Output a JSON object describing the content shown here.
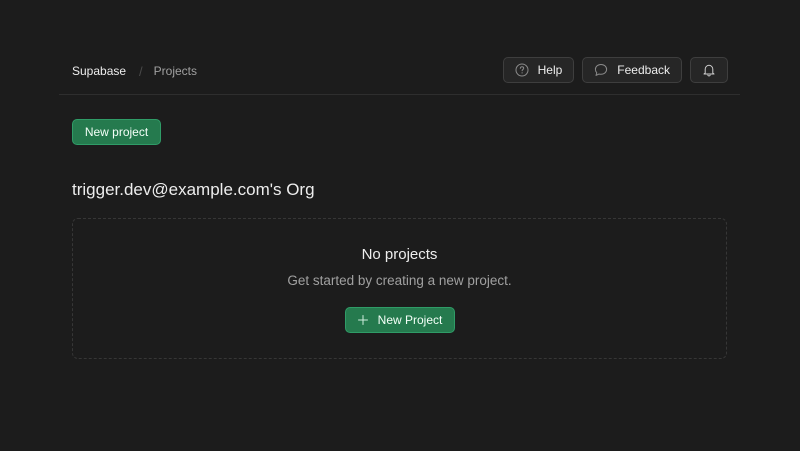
{
  "header": {
    "breadcrumb": {
      "org": "Supabase",
      "separator": "/",
      "page": "Projects"
    },
    "actions": {
      "help_label": "Help",
      "feedback_label": "Feedback",
      "help_icon": "question-circle-icon",
      "feedback_icon": "message-bubble-icon",
      "notifications_icon": "bell-icon"
    }
  },
  "main": {
    "new_project_label": "New project",
    "org_name": "trigger.dev@example.com's Org",
    "empty_state": {
      "title": "No projects",
      "subtitle": "Get started by creating a new project.",
      "button_label": "New Project",
      "button_icon": "plus-icon"
    }
  },
  "colors": {
    "background": "#1c1c1c",
    "brand_green": "#257a4e",
    "text_primary": "#ededed",
    "text_secondary": "#a0a0a0",
    "border": "#3e3e3e"
  }
}
